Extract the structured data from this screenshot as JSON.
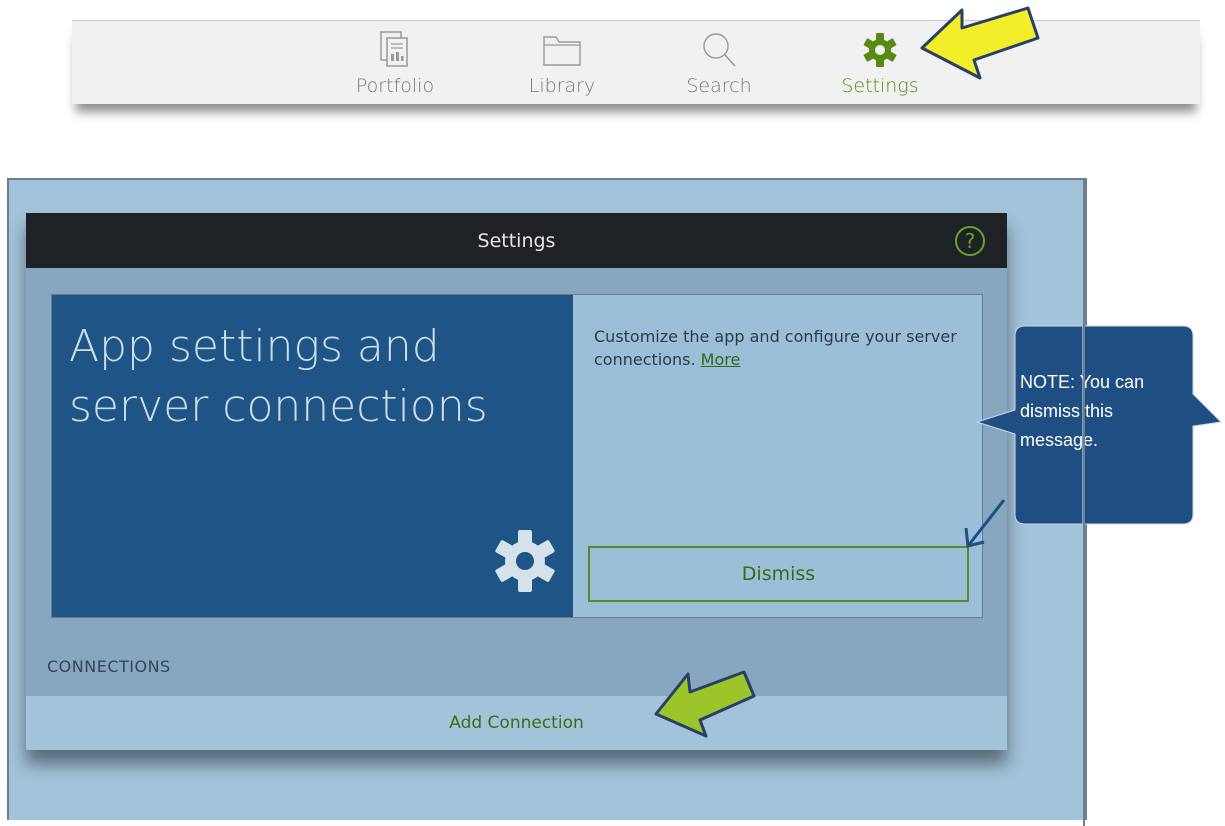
{
  "tabbar": {
    "tabs": [
      {
        "label": "Portfolio",
        "icon": "portfolio-icon",
        "active": false
      },
      {
        "label": "Library",
        "icon": "folder-icon",
        "active": false
      },
      {
        "label": "Search",
        "icon": "search-icon",
        "active": false
      },
      {
        "label": "Settings",
        "icon": "gear-icon",
        "active": true
      }
    ]
  },
  "dialog": {
    "title": "Settings",
    "help_icon": "help-icon",
    "card": {
      "heading": "App settings and server connections",
      "description": "Customize the app and configure your server connections.",
      "more_link": "More",
      "dismiss_label": "Dismiss"
    },
    "connections_label": "CONNECTIONS",
    "add_connection_label": "Add Connection"
  },
  "callout": {
    "text": "NOTE: You can dismiss this message."
  },
  "colors": {
    "accent_green": "#5a8a16",
    "dialog_header": "#1e2226",
    "card_dark_blue": "#1e5486",
    "frame_blue": "#a3c3da",
    "callout_blue": "#1f4e82",
    "arrow_yellow": "#f2ef2a",
    "arrow_green": "#9cc52a"
  }
}
